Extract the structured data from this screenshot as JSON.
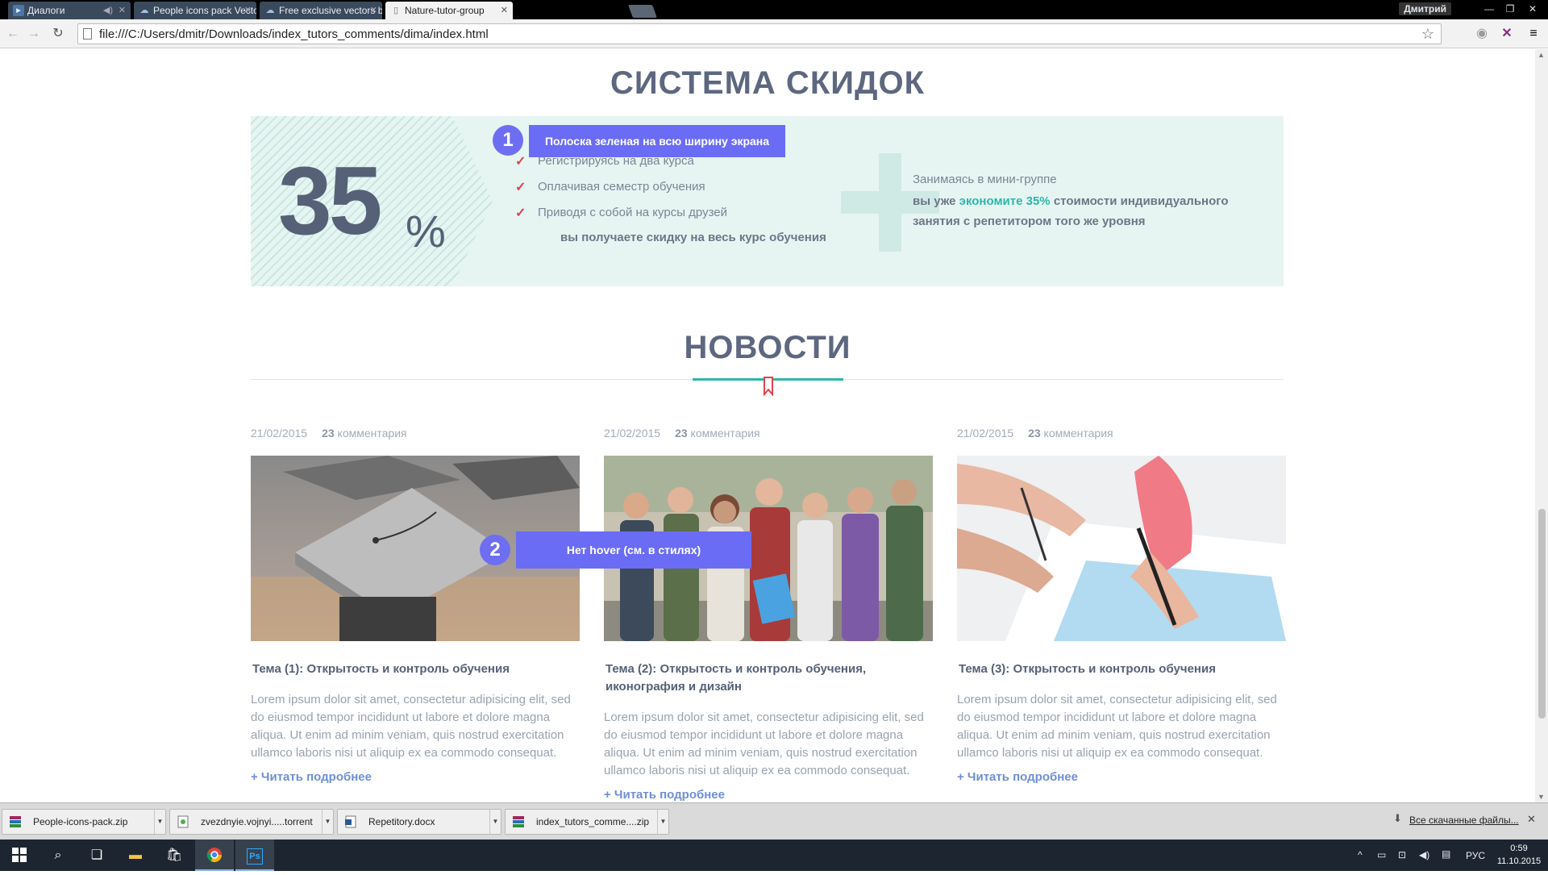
{
  "browser": {
    "tabs": [
      {
        "label": "Диалоги",
        "icon": "vk-icon"
      },
      {
        "label": "People icons pack Vector",
        "icon": "cloud-icon"
      },
      {
        "label": "Free exclusive vectors by",
        "icon": "cloud-icon"
      },
      {
        "label": "Nature-tutor-group",
        "icon": "page-icon"
      }
    ],
    "user_name": "Дмитрий",
    "url": "file:///C:/Users/dmitr/Downloads/index_tutors_comments/dima/index.html"
  },
  "discounts": {
    "title": "СИСТЕМА СКИДОК",
    "big_number": "35",
    "percent_sign": "%",
    "items": [
      "Регистрируясь на два курса",
      "Оплачивая семестр обучения",
      "Приводя с собой на курсы друзей"
    ],
    "summary": "вы получаете скидку на весь курс обучения",
    "group_intro": "Занимаясь в мини-группе",
    "group_prefix": "вы уже ",
    "group_accent": "экономите 35%",
    "group_suffix": " стоимости индивидуального",
    "group_line3": "занятия с репетитором того же уровня"
  },
  "annotations": [
    {
      "number": "1",
      "text": "Полоска зеленая на всю ширину экрана"
    },
    {
      "number": "2",
      "text": "Нет hover (см. в стилях)"
    }
  ],
  "news": {
    "title": "НОВОСТИ",
    "items": [
      {
        "date": "21/02/2015",
        "comments_count": "23",
        "comments_label": "комментария",
        "title": "Тема (1): Открытость и контроль обучения",
        "body": "Lorem ipsum dolor sit amet, consectetur adipisicing elit, sed do eiusmod tempor incididunt ut labore et dolore magna aliqua. Ut enim ad minim veniam, quis nostrud exercitation ullamco laboris nisi ut aliquip ex ea commodo consequat.",
        "more": "+ Читать подробнее"
      },
      {
        "date": "21/02/2015",
        "comments_count": "23",
        "comments_label": "комментария",
        "title": "Тема (2): Открытость и контроль обучения, иконография и дизайн",
        "body": "Lorem ipsum dolor sit amet, consectetur adipisicing elit, sed do eiusmod tempor incididunt ut labore et dolore magna aliqua. Ut enim ad minim veniam, quis nostrud exercitation ullamco laboris nisi ut aliquip ex ea commodo consequat.",
        "more": "+ Читать подробнее"
      },
      {
        "date": "21/02/2015",
        "comments_count": "23",
        "comments_label": "комментария",
        "title": "Тема (3): Открытость и контроль обучения",
        "body": "Lorem ipsum dolor sit amet, consectetur adipisicing elit, sed do eiusmod tempor incididunt ut labore et dolore magna aliqua. Ut enim ad minim veniam, quis nostrud exercitation ullamco laboris nisi ut aliquip ex ea commodo consequat.",
        "more": "+ Читать подробнее"
      }
    ]
  },
  "downloads": {
    "items": [
      {
        "name": "People-icons-pack.zip",
        "icon": "winrar-icon"
      },
      {
        "name": "zvezdnyie.vojnyi.....torrent",
        "icon": "torrent-icon"
      },
      {
        "name": "Repetitory.docx",
        "icon": "word-icon"
      },
      {
        "name": "index_tutors_comme....zip",
        "icon": "winrar-icon"
      }
    ],
    "show_all": "Все скачанные файлы..."
  },
  "taskbar": {
    "language": "РУС",
    "time": "0:59",
    "date": "11.10.2015"
  },
  "colors": {
    "accent": "#2eb6a8",
    "title": "#5d6780",
    "annotation": "#6b6cf5",
    "check": "#e1424a",
    "box_bg": "#e6f5f2"
  }
}
